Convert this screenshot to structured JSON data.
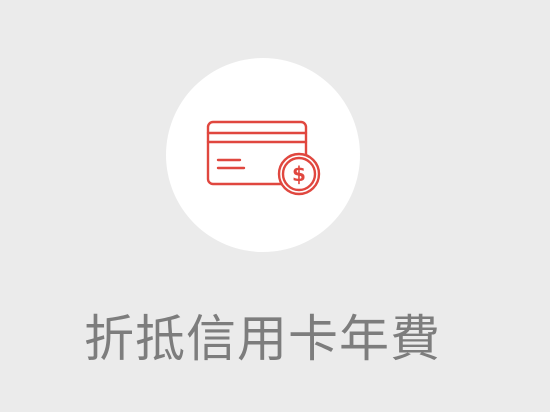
{
  "benefit": {
    "icon": "credit-card-dollar-icon",
    "label": "折抵信用卡年費"
  },
  "colors": {
    "background": "#ebebeb",
    "circle": "#ffffff",
    "icon_stroke": "#e0473f",
    "label_text": "#7d7d7d"
  }
}
